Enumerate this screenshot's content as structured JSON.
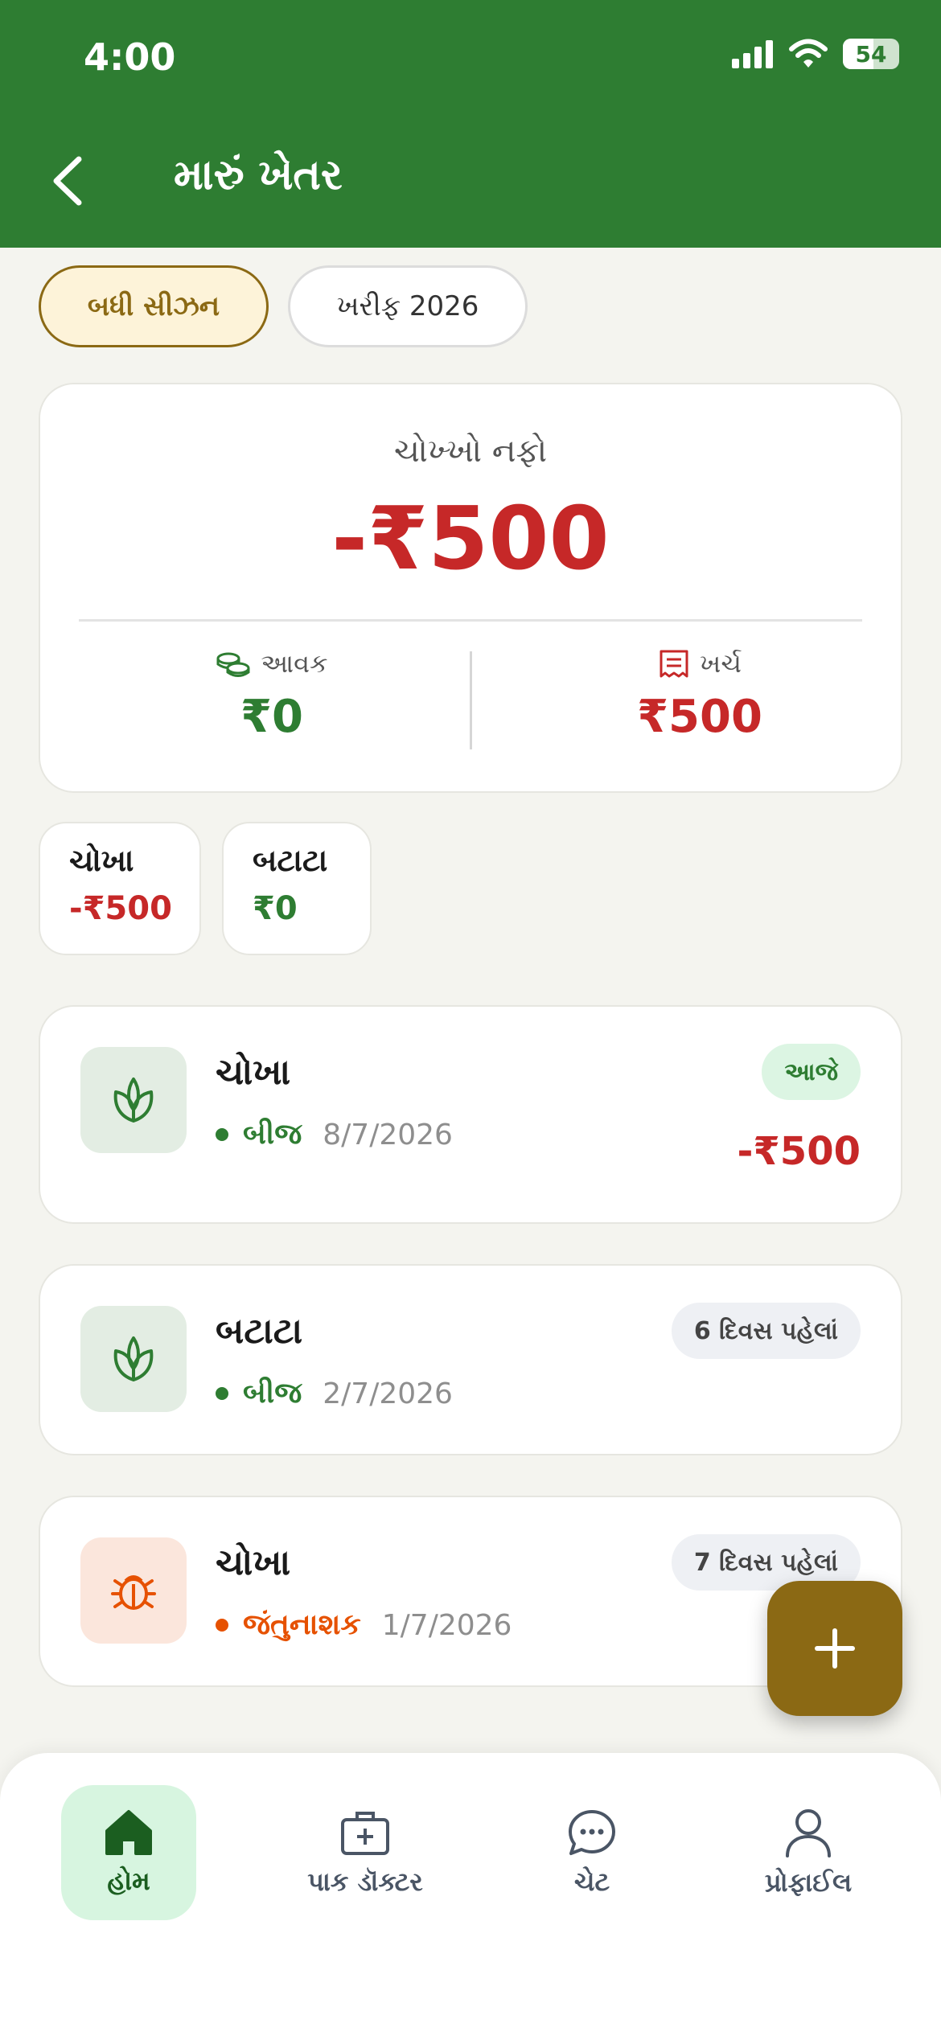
{
  "status_bar": {
    "time": "4:00",
    "battery": "54"
  },
  "header": {
    "title": "મારું ખેતર"
  },
  "seasons": {
    "all": "બધી સીઝન",
    "kharif": "ખરીફ 2026"
  },
  "summary": {
    "net_label": "ચોખ્ખો નફો",
    "net_value": "-₹500",
    "income_label": "આવક",
    "income_value": "₹0",
    "expense_label": "ખર્ચ",
    "expense_value": "₹500"
  },
  "crops": [
    {
      "name": "ચોખા",
      "value": "-₹500"
    },
    {
      "name": "બટાટા",
      "value": "₹0"
    }
  ],
  "activities": [
    {
      "crop": "ચોખા",
      "type": "બીજ",
      "date": "8/7/2026",
      "badge": "આજે",
      "amount": "-₹500",
      "icon": "plant-icon"
    },
    {
      "crop": "બટાટા",
      "type": "બીજ",
      "date": "2/7/2026",
      "badge": "6 દિવસ પહેલાં",
      "icon": "plant-icon"
    },
    {
      "crop": "ચોખા",
      "type": "જંતુનાશક",
      "date": "1/7/2026",
      "badge": "7 દિવસ પહેલાં",
      "icon": "bug-icon"
    }
  ],
  "nav": {
    "home": "હોમ",
    "doctor": "પાક ડૉક્ટર",
    "chat": "ચેટ",
    "profile": "પ્રોફાઈલ"
  },
  "colors": {
    "primary": "#2e7d32",
    "accent": "#8b6914",
    "negative": "#c62828",
    "pesticide": "#e65100"
  }
}
